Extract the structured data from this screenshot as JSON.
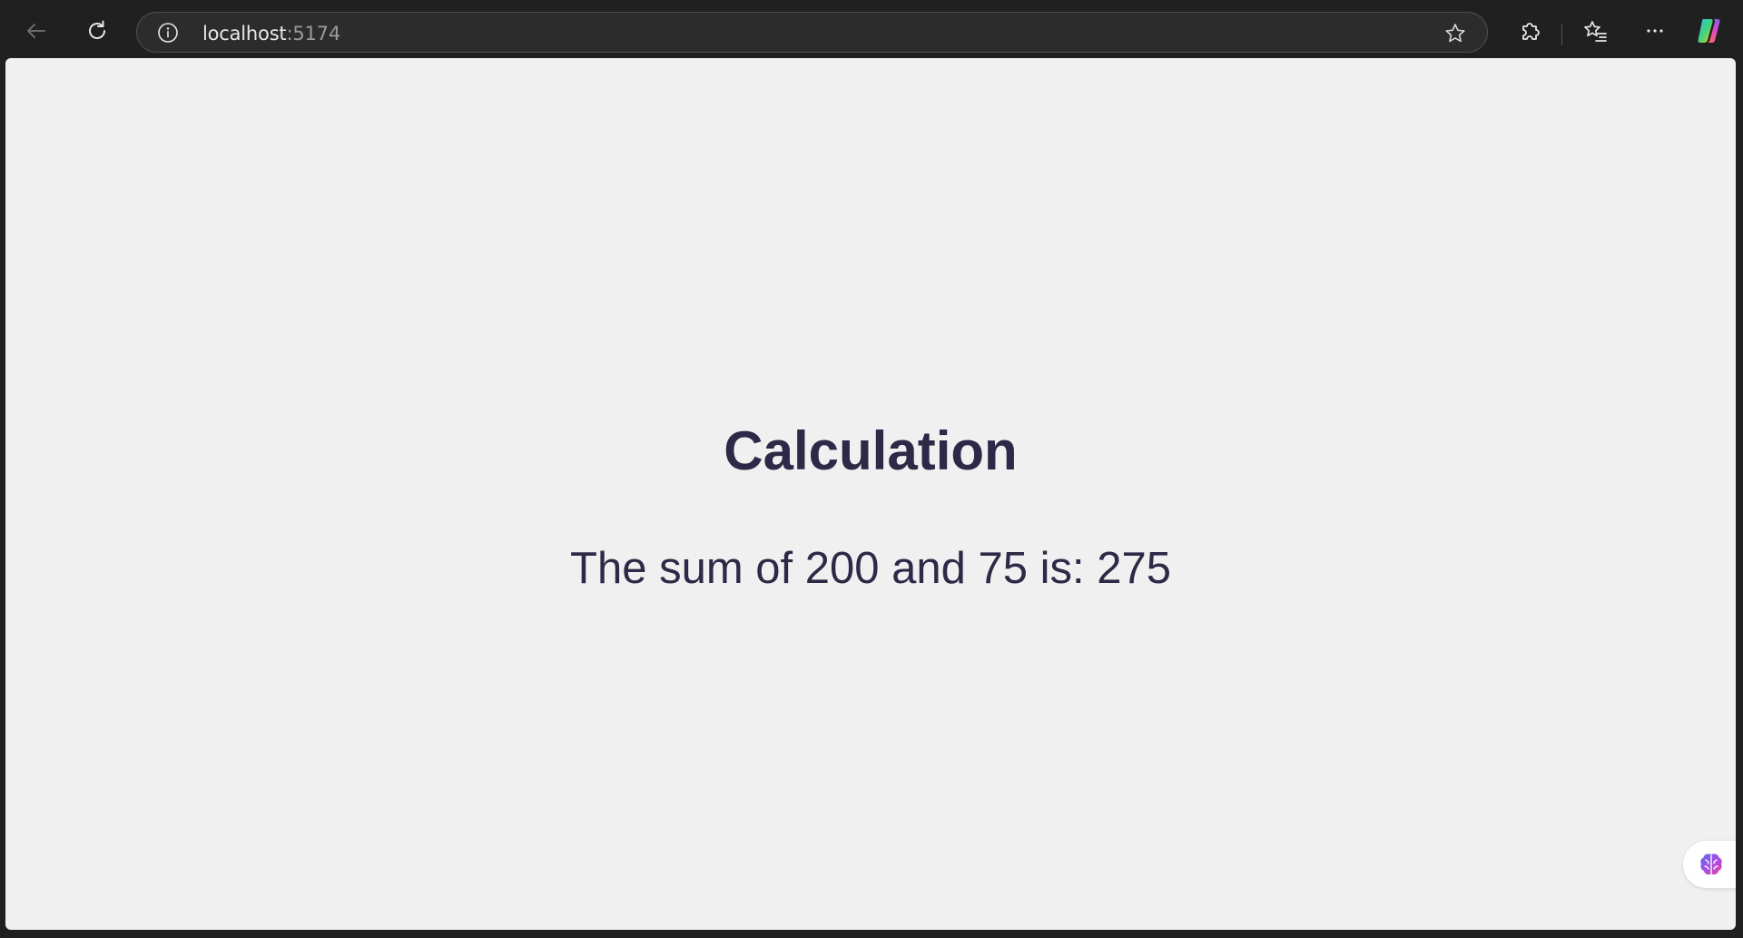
{
  "browser": {
    "url_host": "localhost",
    "url_port": ":5174",
    "icons": {
      "back": "arrow-left-icon",
      "reload": "reload-icon",
      "site_info": "info-icon",
      "favorite": "star-icon",
      "extensions": "puzzle-icon",
      "favorites_list": "favorites-icon",
      "more": "more-icon",
      "copilot": "copilot-icon"
    }
  },
  "page": {
    "title": "Calculation",
    "result_text": "The sum of 200 and 75 is: 275",
    "text_color": "#2f2847",
    "background": "#f0f0f0",
    "floating_button_icon": "brain-icon"
  }
}
